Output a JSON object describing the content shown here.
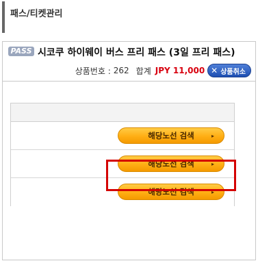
{
  "page": {
    "section_title": "패스/티켓관리"
  },
  "product": {
    "badge": "PASS",
    "name": "시코쿠 하이웨이 버스 프리 패스 (3일 프리 패스)",
    "code_label": "상품번호 :",
    "code": "262",
    "total_label": "합계",
    "price": "JPY 11,000",
    "cancel_label": "상품취소",
    "cancel_icon": "close-icon"
  },
  "routes": {
    "rows": [
      {
        "button_label": "해당노선 검색",
        "arrow": "▸"
      },
      {
        "button_label": "해당노선 검색",
        "arrow": "▸"
      },
      {
        "button_label": "해당노선 검색",
        "arrow": "▸"
      }
    ]
  },
  "colors": {
    "price": "#d8000f",
    "search_button": "#ffae14",
    "cancel_button": "#1d4fb2",
    "highlight": "#d40000"
  }
}
